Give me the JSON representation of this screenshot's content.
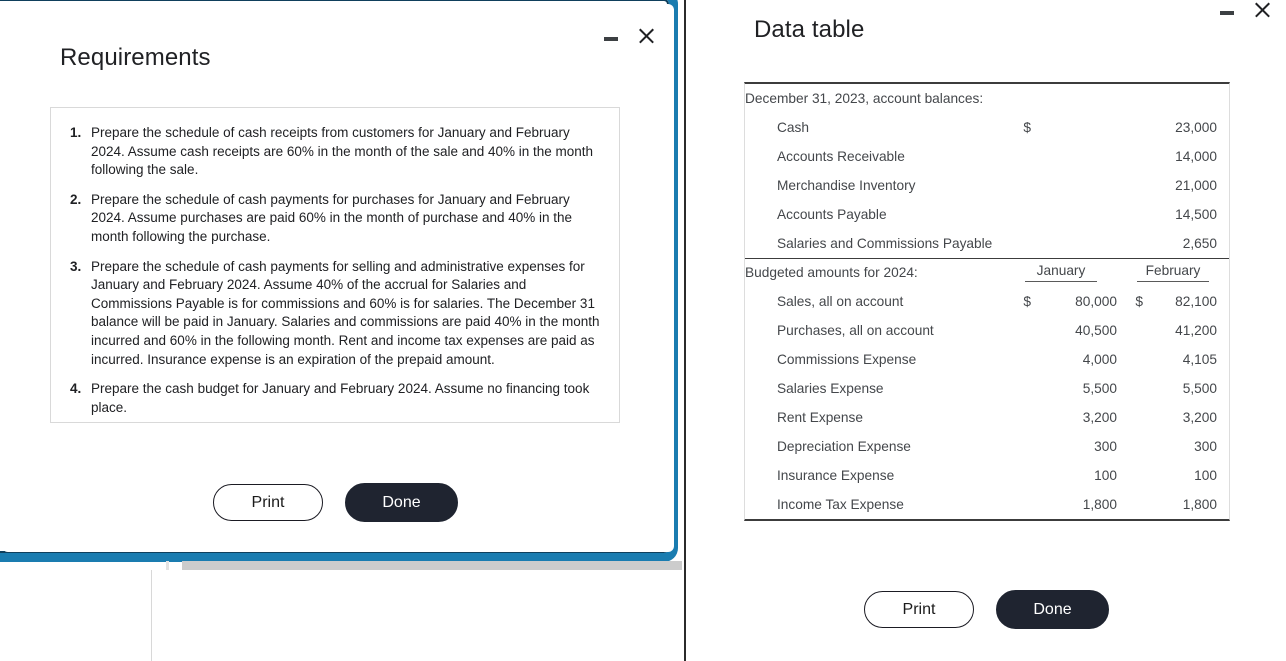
{
  "left_window": {
    "title": "Requirements",
    "minimize_icon": "minimize-icon",
    "close_icon": "close-icon",
    "requirements": [
      {
        "number": "1.",
        "text": "Prepare the schedule of cash receipts from customers for January and February 2024. Assume cash receipts are 60% in the month of the sale and 40% in the month following the sale."
      },
      {
        "number": "2.",
        "text": "Prepare the schedule of cash payments for purchases for January and February 2024. Assume purchases are paid 60% in the month of purchase and 40% in the month following the purchase."
      },
      {
        "number": "3.",
        "text": "Prepare the schedule of cash payments for selling and administrative expenses for January and February 2024. Assume 40% of the accrual for Salaries and Commissions Payable is for commissions and 60% is for salaries. The December 31 balance will be paid in January. Salaries and commissions are paid 40% in the month incurred and 60% in the following month. Rent and income tax expenses are paid as incurred. Insurance expense is an expiration of the prepaid amount."
      },
      {
        "number": "4.",
        "text": "Prepare the cash budget for January and February 2024. Assume no financing took place."
      }
    ],
    "print_label": "Print",
    "done_label": "Done"
  },
  "right_window": {
    "title": "Data table",
    "minimize_icon": "minimize-icon",
    "close_icon": "close-icon",
    "print_label": "Print",
    "done_label": "Done",
    "table": {
      "section1_header": "December 31, 2023, account balances:",
      "section1_rows": [
        {
          "label": "Cash",
          "currency": "$",
          "value": "23,000"
        },
        {
          "label": "Accounts Receivable",
          "currency": "",
          "value": "14,000"
        },
        {
          "label": "Merchandise Inventory",
          "currency": "",
          "value": "21,000"
        },
        {
          "label": "Accounts Payable",
          "currency": "",
          "value": "14,500"
        },
        {
          "label": "Salaries and Commissions Payable",
          "currency": "",
          "value": "2,650"
        }
      ],
      "section2_header": "Budgeted amounts for 2024:",
      "column_headers": [
        "January",
        "February"
      ],
      "section2_rows": [
        {
          "label": "Sales, all on account",
          "jan_currency": "$",
          "jan": "80,000",
          "feb_currency": "$",
          "feb": "82,100"
        },
        {
          "label": "Purchases, all on account",
          "jan_currency": "",
          "jan": "40,500",
          "feb_currency": "",
          "feb": "41,200"
        },
        {
          "label": "Commissions Expense",
          "jan_currency": "",
          "jan": "4,000",
          "feb_currency": "",
          "feb": "4,105"
        },
        {
          "label": "Salaries Expense",
          "jan_currency": "",
          "jan": "5,500",
          "feb_currency": "",
          "feb": "5,500"
        },
        {
          "label": "Rent Expense",
          "jan_currency": "",
          "jan": "3,200",
          "feb_currency": "",
          "feb": "3,200"
        },
        {
          "label": "Depreciation Expense",
          "jan_currency": "",
          "jan": "300",
          "feb_currency": "",
          "feb": "300"
        },
        {
          "label": "Insurance Expense",
          "jan_currency": "",
          "jan": "100",
          "feb_currency": "",
          "feb": "100"
        },
        {
          "label": "Income Tax Expense",
          "jan_currency": "",
          "jan": "1,800",
          "feb_currency": "",
          "feb": "1,800"
        }
      ]
    }
  },
  "theme": {
    "frame_blue": "#1a7cb0",
    "frame_dark": "#123a52",
    "button_dark": "#1f2430",
    "text_dark": "#202124",
    "table_text": "#44474b"
  }
}
